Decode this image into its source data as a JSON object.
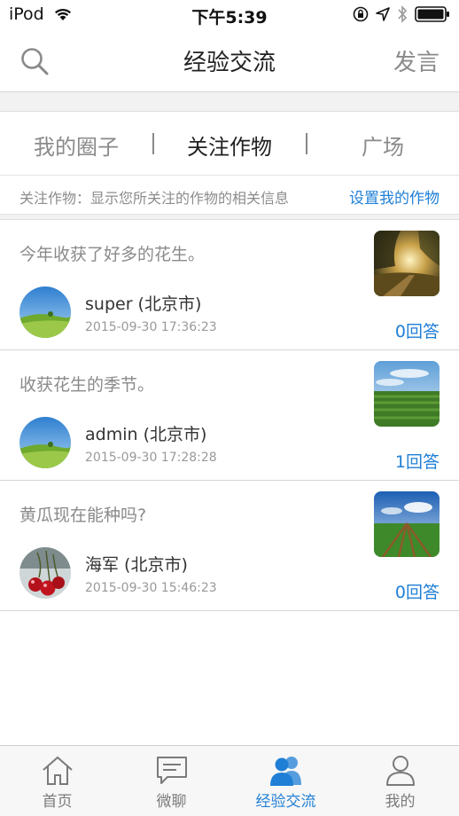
{
  "status_bar": {
    "carrier": "iPod",
    "time": "下午5:39"
  },
  "nav": {
    "title": "经验交流",
    "post_label": "发言"
  },
  "tabs": [
    {
      "label": "我的圈子",
      "active": false
    },
    {
      "label": "关注作物",
      "active": true
    },
    {
      "label": "广场",
      "active": false
    }
  ],
  "info": {
    "text": "关注作物：显示您所关注的作物的相关信息",
    "link": "设置我的作物"
  },
  "posts": [
    {
      "title": "今年收获了好多的花生。",
      "user": "super (北京市)",
      "time": "2015-09-30 17:36:23",
      "answers": "0回答"
    },
    {
      "title": "收获花生的季节。",
      "user": "admin (北京市)",
      "time": "2015-09-30 17:28:28",
      "answers": "1回答"
    },
    {
      "title": "黄瓜现在能种吗?",
      "user": "海军 (北京市)",
      "time": "2015-09-30 15:46:23",
      "answers": "0回答"
    }
  ],
  "tab_bar": [
    {
      "label": "首页",
      "icon": "home-icon",
      "active": false
    },
    {
      "label": "微聊",
      "icon": "chat-icon",
      "active": false
    },
    {
      "label": "经验交流",
      "icon": "users-icon",
      "active": true
    },
    {
      "label": "我的",
      "icon": "person-icon",
      "active": false
    }
  ],
  "colors": {
    "accent": "#1f7fd6"
  }
}
